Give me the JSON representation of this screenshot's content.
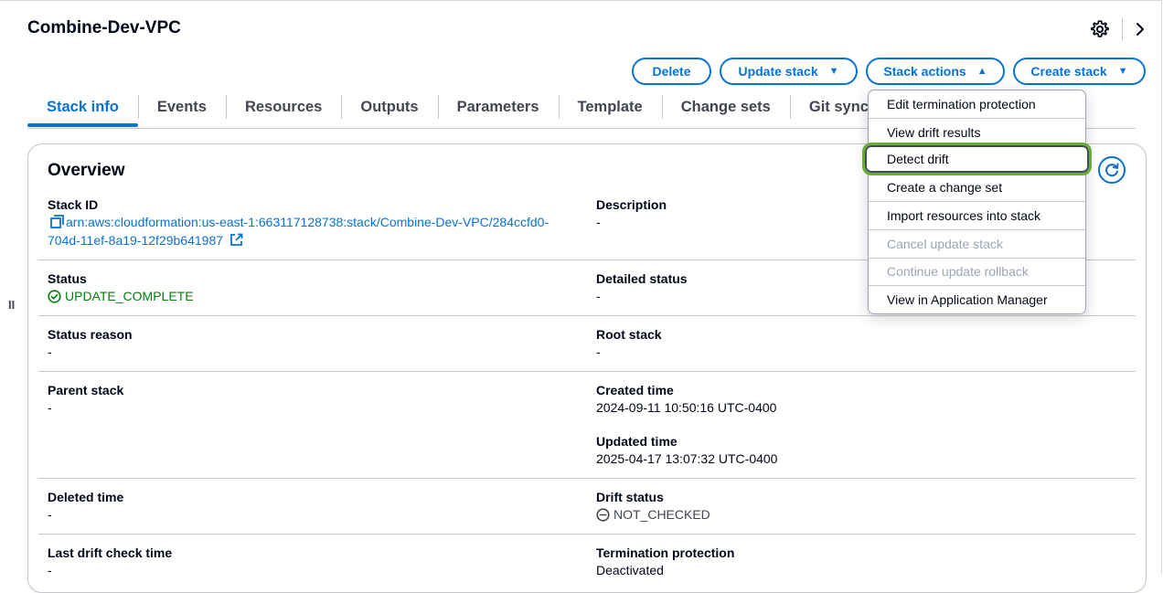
{
  "header": {
    "title": "Combine-Dev-VPC",
    "icons": [
      "gear-icon",
      "chevron-right-icon"
    ]
  },
  "actions": {
    "delete": "Delete",
    "update": "Update stack",
    "stack_actions": "Stack actions",
    "create": "Create stack"
  },
  "tabs": [
    "Stack info",
    "Events",
    "Resources",
    "Outputs",
    "Parameters",
    "Template",
    "Change sets",
    "Git sync"
  ],
  "overview": {
    "title": "Overview",
    "stack_id_label": "Stack ID",
    "stack_id_line1": "arn:aws:cloudformation:us-east-1:663117128738:stack/Combine-Dev-VPC/284ccfd0-",
    "stack_id_line2": "704d-11ef-8a19-12f29b641987",
    "description_label": "Description",
    "description_value": "-",
    "status_label": "Status",
    "status_value": "UPDATE_COMPLETE",
    "detailed_status_label": "Detailed status",
    "detailed_status_value": "-",
    "status_reason_label": "Status reason",
    "status_reason_value": "-",
    "root_stack_label": "Root stack",
    "root_stack_value": "-",
    "parent_stack_label": "Parent stack",
    "parent_stack_value": "-",
    "created_time_label": "Created time",
    "created_time_value": "2024-09-11 10:50:16 UTC-0400",
    "updated_time_label": "Updated time",
    "updated_time_value": "2025-04-17 13:07:32 UTC-0400",
    "deleted_time_label": "Deleted time",
    "deleted_time_value": "-",
    "drift_status_label": "Drift status",
    "drift_status_value": "NOT_CHECKED",
    "last_drift_label": "Last drift check time",
    "last_drift_value": "-",
    "termination_label": "Termination protection",
    "termination_value": "Deactivated"
  },
  "menu": {
    "items": [
      "Edit termination protection",
      "View drift results",
      "Detect drift",
      "Create a change set",
      "Import resources into stack",
      "Cancel update stack",
      "Continue update rollback",
      "View in Application Manager"
    ]
  },
  "colors": {
    "accent": "#0972d3",
    "success": "#037f0c",
    "highlight": "#69ae34"
  }
}
